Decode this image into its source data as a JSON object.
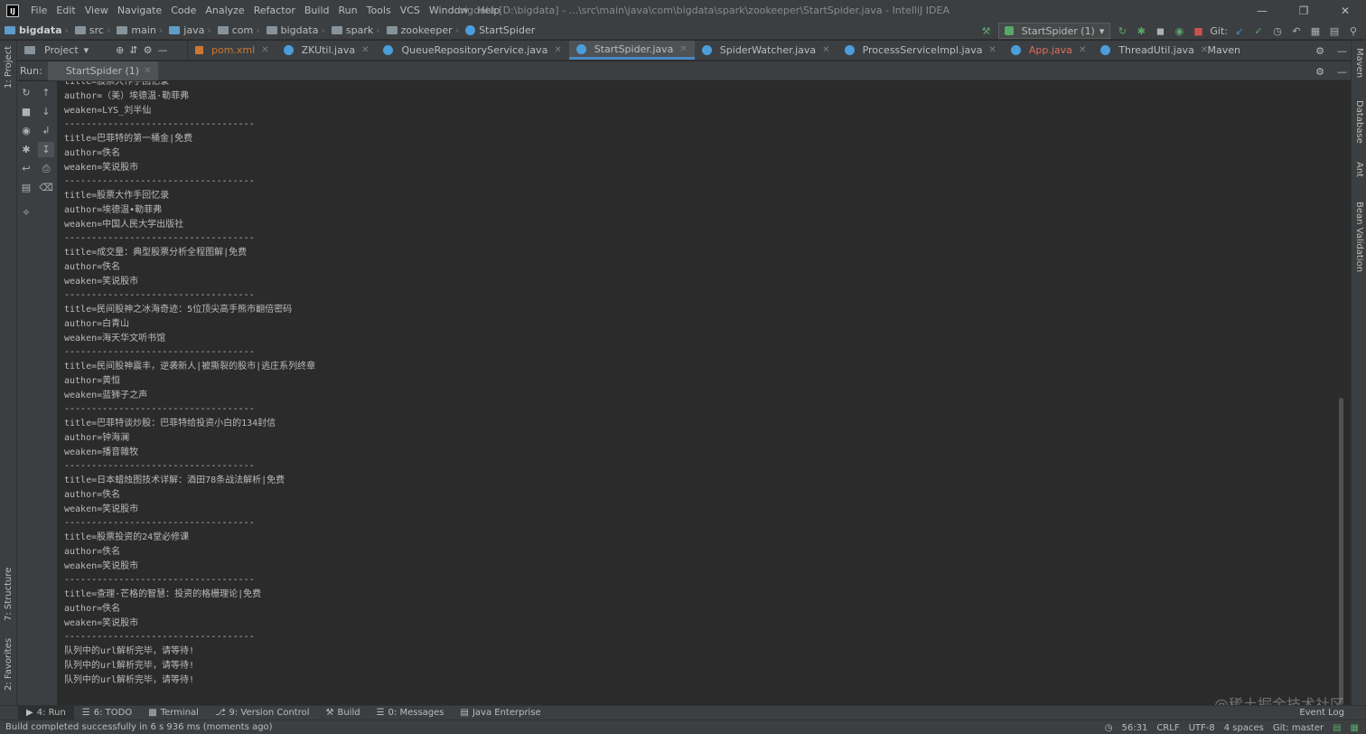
{
  "window": {
    "title": "bigdata [D:\\bigdata] - ...\\src\\main\\java\\com\\bigdata\\spark\\zookeeper\\StartSpider.java - IntelliJ IDEA",
    "logo": "IJ"
  },
  "menu": [
    "File",
    "Edit",
    "View",
    "Navigate",
    "Code",
    "Analyze",
    "Refactor",
    "Build",
    "Run",
    "Tools",
    "VCS",
    "Window",
    "Help"
  ],
  "breadcrumbs": [
    {
      "label": "bigdata",
      "icon": "folder-icon"
    },
    {
      "label": "src",
      "icon": "folder-icon"
    },
    {
      "label": "main",
      "icon": "folder-icon"
    },
    {
      "label": "java",
      "icon": "folder-icon"
    },
    {
      "label": "com",
      "icon": "folder-icon"
    },
    {
      "label": "bigdata",
      "icon": "folder-icon"
    },
    {
      "label": "spark",
      "icon": "folder-icon"
    },
    {
      "label": "zookeeper",
      "icon": "folder-icon"
    },
    {
      "label": "StartSpider",
      "icon": "class-icon"
    }
  ],
  "toolbar": {
    "run_config": "StartSpider (1)",
    "git_label": "Git:"
  },
  "project_tab": {
    "label": "Project"
  },
  "editor_tabs": [
    {
      "label": "pom.xml",
      "kind": "xml"
    },
    {
      "label": "ZKUtil.java",
      "kind": "java"
    },
    {
      "label": "QueueRepositoryService.java",
      "kind": "java"
    },
    {
      "label": "StartSpider.java",
      "kind": "java",
      "active": true
    },
    {
      "label": "SpiderWatcher.java",
      "kind": "java"
    },
    {
      "label": "ProcessServiceImpl.java",
      "kind": "java"
    },
    {
      "label": "App.java",
      "kind": "app"
    },
    {
      "label": "ThreadUtil.java",
      "kind": "java"
    }
  ],
  "maven_label": "Maven",
  "run_panel": {
    "label": "Run:",
    "tab": "StartSpider (1)"
  },
  "console_lines": [
    "title=股票大作手回忆录",
    "author=（美）埃德温·勒菲弗",
    "weaken=LYS_刘半仙",
    "-----------------------------------",
    "title=巴菲特的第一桶金|免费",
    "author=佚名",
    "weaken=笑说股市",
    "-----------------------------------",
    "title=股票大作手回忆录",
    "author=埃德温•勒菲弗",
    "weaken=中国人民大学出版社",
    "-----------------------------------",
    "title=成交量：典型股票分析全程图解|免费",
    "author=佚名",
    "weaken=笑说股市",
    "-----------------------------------",
    "title=民间股神之冰海奇迹：5位顶尖高手熊市翻倍密码",
    "author=白青山",
    "weaken=海天华文听书馆",
    "-----------------------------------",
    "title=民间股神震丰，逆袭新人|被撕裂的股市|逃庄系列终章",
    "author=黄恒",
    "weaken=蓝狮子之声",
    "-----------------------------------",
    "title=巴菲特谈炒股：巴菲特给投资小白的134封信",
    "author=钟海澜",
    "weaken=播音雜牧",
    "-----------------------------------",
    "title=日本蜡烛图技术详解：酒田78条战法解析|免费",
    "author=佚名",
    "weaken=笑说股市",
    "-----------------------------------",
    "title=股票投资的24堂必修课",
    "author=佚名",
    "weaken=笑说股市",
    "-----------------------------------",
    "title=查理·芒格的智慧：投资的格栅理论|免费",
    "author=佚名",
    "weaken=笑说股市",
    "-----------------------------------",
    "队列中的url解析完毕，请等待!",
    "队列中的url解析完毕，请等待!",
    "队列中的url解析完毕，请等待!"
  ],
  "left_strip": {
    "project": "1: Project",
    "structure": "7: Structure",
    "favorites": "2: Favorites"
  },
  "right_strip": {
    "maven": "Maven",
    "database": "Database",
    "ant": "Ant",
    "bean": "Bean Validation"
  },
  "bottom_tabs": [
    {
      "label": "4: Run",
      "icon": "run-icon",
      "active": true
    },
    {
      "label": "6: TODO",
      "icon": "todo-icon"
    },
    {
      "label": "Terminal",
      "icon": "terminal-icon"
    },
    {
      "label": "9: Version Control",
      "icon": "vcs-icon"
    },
    {
      "label": "Build",
      "icon": "hammer-icon"
    },
    {
      "label": "0: Messages",
      "icon": "messages-icon"
    },
    {
      "label": "Java Enterprise",
      "icon": "java-enterprise-icon"
    }
  ],
  "event_log": "Event Log",
  "status": {
    "message": "Build completed successfully in 6 s 936 ms (moments ago)",
    "position": "56:31",
    "line_sep": "CRLF",
    "encoding": "UTF-8",
    "indent": "4 spaces",
    "git": "Git: master"
  },
  "watermark": "@稀土掘金技术社区",
  "colors": {
    "accent": "#4a88c7",
    "background": "#2b2b2b",
    "panel": "#3c3f41",
    "text": "#bbbbbb"
  }
}
